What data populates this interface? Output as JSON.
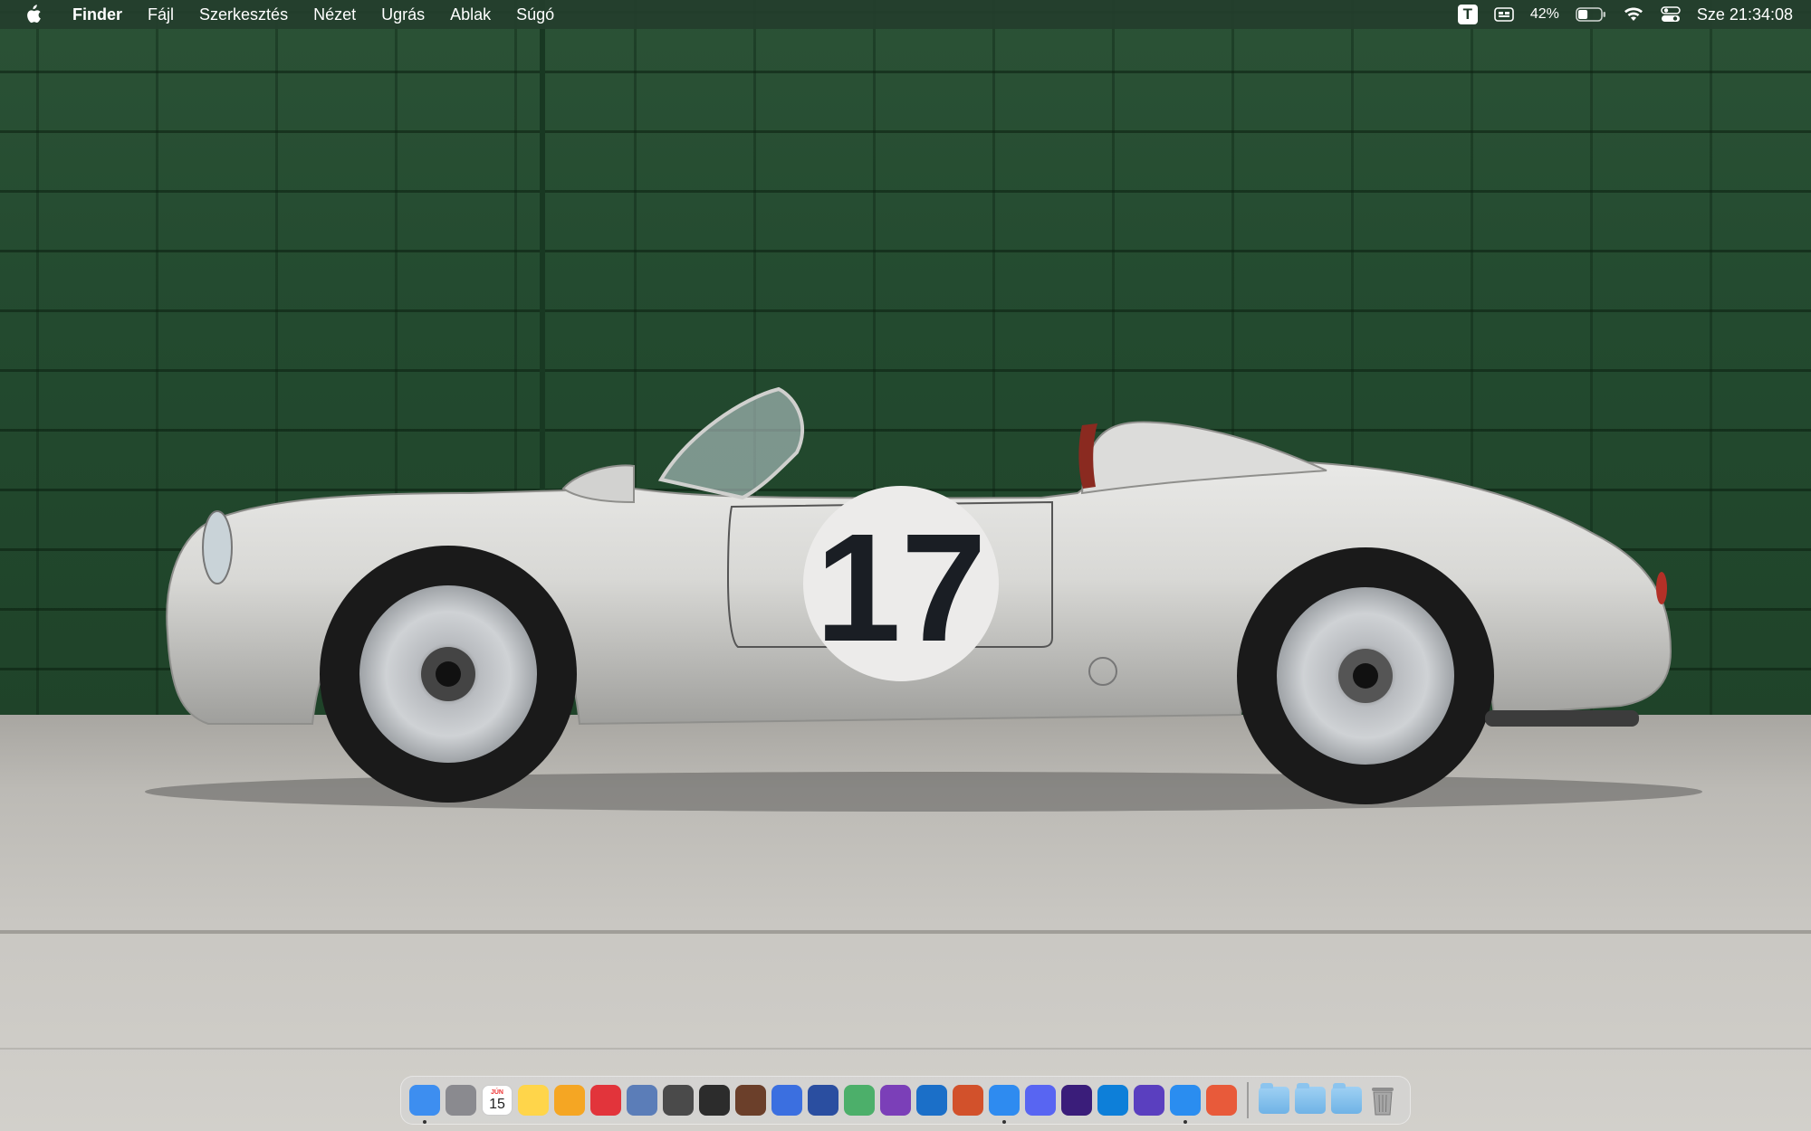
{
  "menubar": {
    "apple": "apple-icon",
    "app_name": "Finder",
    "menus": [
      "Fájl",
      "Szerkesztés",
      "Nézet",
      "Ugrás",
      "Ablak",
      "Súgó"
    ],
    "status": {
      "text_app_icon": "T",
      "battery_percent": "42%",
      "battery_level": 0.42,
      "clock": "Sze 21:34:08"
    }
  },
  "wallpaper": {
    "description_icon": "car-wallpaper",
    "race_number": "17"
  },
  "dock": {
    "apps": [
      {
        "name": "finder-icon",
        "color": "#3d8ef0",
        "running": true
      },
      {
        "name": "system-preferences-icon",
        "color": "#8a8a8f",
        "running": false
      },
      {
        "name": "calendar-icon",
        "color": "#ffffff",
        "running": false,
        "month": "JÚN",
        "day": "15"
      },
      {
        "name": "notes-icon",
        "color": "#ffd54a",
        "running": false
      },
      {
        "name": "pages-icon",
        "color": "#f5a623",
        "running": false
      },
      {
        "name": "pdf-app-icon",
        "color": "#e2343b",
        "running": false
      },
      {
        "name": "preview-icon",
        "color": "#5b7db8",
        "running": false
      },
      {
        "name": "calculator-icon",
        "color": "#4a4a4a",
        "running": false
      },
      {
        "name": "camera-app-icon",
        "color": "#2c2c2c",
        "running": false
      },
      {
        "name": "coffee-app-icon",
        "color": "#6b3f2a",
        "running": false
      },
      {
        "name": "xcode-icon",
        "color": "#3b6fe0",
        "running": false
      },
      {
        "name": "database-app-icon",
        "color": "#2a4ea0",
        "running": false
      },
      {
        "name": "maps-app-icon",
        "color": "#4caf6a",
        "running": false
      },
      {
        "name": "affinity-photo-icon",
        "color": "#7b3fb8",
        "running": false
      },
      {
        "name": "affinity-designer-icon",
        "color": "#1b6fc8",
        "running": false
      },
      {
        "name": "affinity-publisher-icon",
        "color": "#d2512b",
        "running": false
      },
      {
        "name": "mail-icon",
        "color": "#2e8bf0",
        "running": true
      },
      {
        "name": "discord-icon",
        "color": "#5865f2",
        "running": false
      },
      {
        "name": "stocks-app-icon",
        "color": "#3a1d7a",
        "running": false
      },
      {
        "name": "skype-icon",
        "color": "#0d7fd9",
        "running": false
      },
      {
        "name": "vpn-shield-icon",
        "color": "#5a3fbf",
        "running": false
      },
      {
        "name": "safari-icon",
        "color": "#2a8df0",
        "running": true
      },
      {
        "name": "pixelmator-icon",
        "color": "#e85a3a",
        "running": false
      }
    ],
    "folders": [
      {
        "name": "screenshots-folder-icon"
      },
      {
        "name": "documents-folder-icon"
      },
      {
        "name": "downloads-folder-icon"
      }
    ],
    "trash": "trash-icon"
  }
}
